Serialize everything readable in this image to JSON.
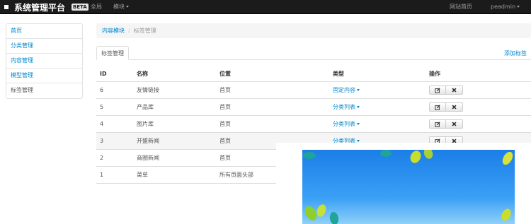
{
  "topbar": {
    "brand": "系统管理平台",
    "badge": "BETA",
    "nav": [
      {
        "label": "全局"
      },
      {
        "label": "模块"
      }
    ],
    "right": [
      {
        "label": "网站首页"
      },
      {
        "label": "peadmin"
      }
    ]
  },
  "sidebar": {
    "items": [
      {
        "label": "首页"
      },
      {
        "label": "分类管理"
      },
      {
        "label": "内容管理"
      },
      {
        "label": "模型管理"
      },
      {
        "label": "标签管理"
      }
    ]
  },
  "breadcrumb": {
    "parent": "内容模块",
    "separator": "/",
    "current": "标签管理"
  },
  "tab": {
    "label": "标签管理"
  },
  "add_link": "添加标签",
  "table": {
    "headers": {
      "id": "ID",
      "name": "名称",
      "position": "位置",
      "type": "类型",
      "ops": "操作"
    },
    "rows": [
      {
        "id": "6",
        "name": "友情链接",
        "position": "首页",
        "type": "固定内容"
      },
      {
        "id": "5",
        "name": "产品库",
        "position": "首页",
        "type": "分类列表"
      },
      {
        "id": "4",
        "name": "图片库",
        "position": "首页",
        "type": "分类列表"
      },
      {
        "id": "3",
        "name": "开盟新闻",
        "position": "首页",
        "type": "分类列表"
      },
      {
        "id": "2",
        "name": "商圈新闻",
        "position": "首页",
        "type": ""
      },
      {
        "id": "1",
        "name": "菜单",
        "position": "所有页面头部",
        "type": ""
      }
    ]
  },
  "colors": {
    "topbar_bg": "#1b1b1b",
    "link": "#0088cc",
    "banner_sky": "#2b8ff0",
    "leaf": "#8fcf2a"
  },
  "icons": [
    "edit-icon",
    "delete-icon",
    "caret-down-icon"
  ]
}
